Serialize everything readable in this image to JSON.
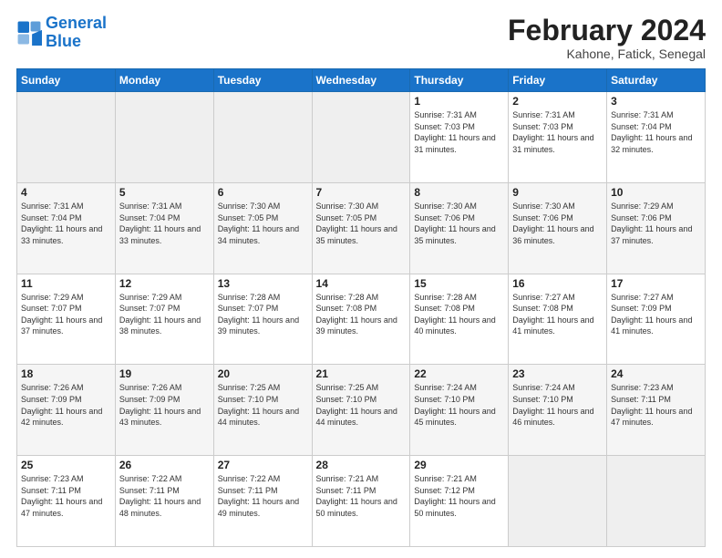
{
  "header": {
    "logo_line1": "General",
    "logo_line2": "Blue",
    "month": "February 2024",
    "location": "Kahone, Fatick, Senegal"
  },
  "weekdays": [
    "Sunday",
    "Monday",
    "Tuesday",
    "Wednesday",
    "Thursday",
    "Friday",
    "Saturday"
  ],
  "weeks": [
    [
      {
        "day": "",
        "info": ""
      },
      {
        "day": "",
        "info": ""
      },
      {
        "day": "",
        "info": ""
      },
      {
        "day": "",
        "info": ""
      },
      {
        "day": "1",
        "info": "Sunrise: 7:31 AM\nSunset: 7:03 PM\nDaylight: 11 hours\nand 31 minutes."
      },
      {
        "day": "2",
        "info": "Sunrise: 7:31 AM\nSunset: 7:03 PM\nDaylight: 11 hours\nand 31 minutes."
      },
      {
        "day": "3",
        "info": "Sunrise: 7:31 AM\nSunset: 7:04 PM\nDaylight: 11 hours\nand 32 minutes."
      }
    ],
    [
      {
        "day": "4",
        "info": "Sunrise: 7:31 AM\nSunset: 7:04 PM\nDaylight: 11 hours\nand 33 minutes."
      },
      {
        "day": "5",
        "info": "Sunrise: 7:31 AM\nSunset: 7:04 PM\nDaylight: 11 hours\nand 33 minutes."
      },
      {
        "day": "6",
        "info": "Sunrise: 7:30 AM\nSunset: 7:05 PM\nDaylight: 11 hours\nand 34 minutes."
      },
      {
        "day": "7",
        "info": "Sunrise: 7:30 AM\nSunset: 7:05 PM\nDaylight: 11 hours\nand 35 minutes."
      },
      {
        "day": "8",
        "info": "Sunrise: 7:30 AM\nSunset: 7:06 PM\nDaylight: 11 hours\nand 35 minutes."
      },
      {
        "day": "9",
        "info": "Sunrise: 7:30 AM\nSunset: 7:06 PM\nDaylight: 11 hours\nand 36 minutes."
      },
      {
        "day": "10",
        "info": "Sunrise: 7:29 AM\nSunset: 7:06 PM\nDaylight: 11 hours\nand 37 minutes."
      }
    ],
    [
      {
        "day": "11",
        "info": "Sunrise: 7:29 AM\nSunset: 7:07 PM\nDaylight: 11 hours\nand 37 minutes."
      },
      {
        "day": "12",
        "info": "Sunrise: 7:29 AM\nSunset: 7:07 PM\nDaylight: 11 hours\nand 38 minutes."
      },
      {
        "day": "13",
        "info": "Sunrise: 7:28 AM\nSunset: 7:07 PM\nDaylight: 11 hours\nand 39 minutes."
      },
      {
        "day": "14",
        "info": "Sunrise: 7:28 AM\nSunset: 7:08 PM\nDaylight: 11 hours\nand 39 minutes."
      },
      {
        "day": "15",
        "info": "Sunrise: 7:28 AM\nSunset: 7:08 PM\nDaylight: 11 hours\nand 40 minutes."
      },
      {
        "day": "16",
        "info": "Sunrise: 7:27 AM\nSunset: 7:08 PM\nDaylight: 11 hours\nand 41 minutes."
      },
      {
        "day": "17",
        "info": "Sunrise: 7:27 AM\nSunset: 7:09 PM\nDaylight: 11 hours\nand 41 minutes."
      }
    ],
    [
      {
        "day": "18",
        "info": "Sunrise: 7:26 AM\nSunset: 7:09 PM\nDaylight: 11 hours\nand 42 minutes."
      },
      {
        "day": "19",
        "info": "Sunrise: 7:26 AM\nSunset: 7:09 PM\nDaylight: 11 hours\nand 43 minutes."
      },
      {
        "day": "20",
        "info": "Sunrise: 7:25 AM\nSunset: 7:10 PM\nDaylight: 11 hours\nand 44 minutes."
      },
      {
        "day": "21",
        "info": "Sunrise: 7:25 AM\nSunset: 7:10 PM\nDaylight: 11 hours\nand 44 minutes."
      },
      {
        "day": "22",
        "info": "Sunrise: 7:24 AM\nSunset: 7:10 PM\nDaylight: 11 hours\nand 45 minutes."
      },
      {
        "day": "23",
        "info": "Sunrise: 7:24 AM\nSunset: 7:10 PM\nDaylight: 11 hours\nand 46 minutes."
      },
      {
        "day": "24",
        "info": "Sunrise: 7:23 AM\nSunset: 7:11 PM\nDaylight: 11 hours\nand 47 minutes."
      }
    ],
    [
      {
        "day": "25",
        "info": "Sunrise: 7:23 AM\nSunset: 7:11 PM\nDaylight: 11 hours\nand 47 minutes."
      },
      {
        "day": "26",
        "info": "Sunrise: 7:22 AM\nSunset: 7:11 PM\nDaylight: 11 hours\nand 48 minutes."
      },
      {
        "day": "27",
        "info": "Sunrise: 7:22 AM\nSunset: 7:11 PM\nDaylight: 11 hours\nand 49 minutes."
      },
      {
        "day": "28",
        "info": "Sunrise: 7:21 AM\nSunset: 7:11 PM\nDaylight: 11 hours\nand 50 minutes."
      },
      {
        "day": "29",
        "info": "Sunrise: 7:21 AM\nSunset: 7:12 PM\nDaylight: 11 hours\nand 50 minutes."
      },
      {
        "day": "",
        "info": ""
      },
      {
        "day": "",
        "info": ""
      }
    ]
  ]
}
